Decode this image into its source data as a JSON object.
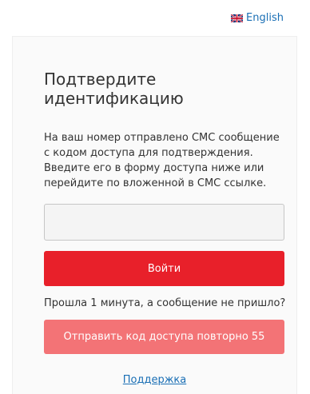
{
  "language": {
    "flag_icon": "uk-flag-icon",
    "label": "English"
  },
  "card": {
    "title": "Подтвердите идентификацию",
    "description": "На ваш номер отправлено СМС сообщение с кодом доступа для подтверждения. Введите его в форму доступа ниже или перейдите по вложенной в СМС ссылке.",
    "code_input": {
      "value": "",
      "placeholder": ""
    },
    "login_label": "Войти",
    "hint": "Прошла 1 минута, а сообщение не пришло?",
    "resend_label": "Отправить код доступа повторно 55",
    "support_label": "Поддержка"
  },
  "colors": {
    "primary_red": "#e8202a",
    "disabled_red": "#f37376",
    "link_blue": "#1a6fb5"
  }
}
